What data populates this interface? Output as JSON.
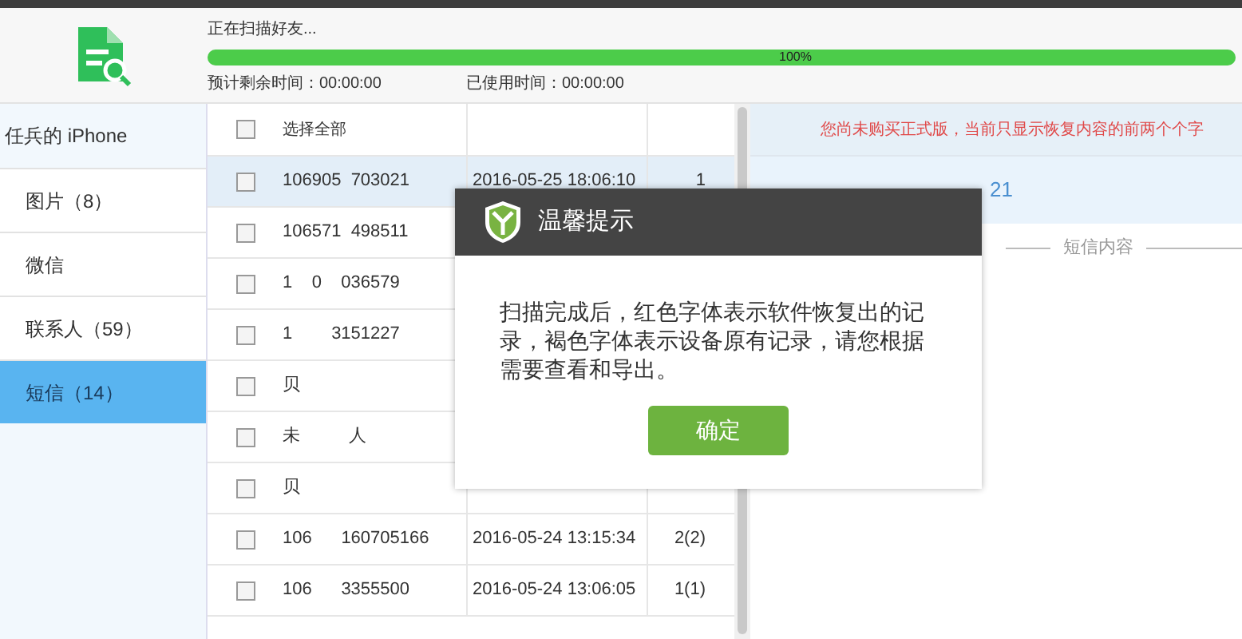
{
  "header": {
    "status": "正在扫描好友...",
    "progress": {
      "level": 1,
      "label": "100%"
    },
    "remaining": "预计剩余时间：00:00:00",
    "elapsed": "已使用时间：00:00:00"
  },
  "sidebar": {
    "device": "任兵的 iPhone",
    "items": [
      {
        "label": "图片（8）",
        "selected": false
      },
      {
        "label": "微信",
        "selected": false
      },
      {
        "label": "联系人（59）",
        "selected": false
      },
      {
        "label": "短信（14）",
        "selected": true
      }
    ]
  },
  "table": {
    "select_all": {
      "label": "选择全部",
      "checked": false
    },
    "rows": [
      {
        "sender": "106905  703021",
        "time": "2016-05-25 18:06:10",
        "count": "1",
        "checked": false,
        "selected": true
      },
      {
        "sender": "106571  498511",
        "checked": false,
        "selected": false
      },
      {
        "sender": "1    0    036579",
        "checked": false,
        "selected": false
      },
      {
        "sender": "1        3151227",
        "checked": false,
        "selected": false
      },
      {
        "sender": "贝",
        "checked": false,
        "selected": false
      },
      {
        "sender": "未          人",
        "checked": false,
        "selected": false
      },
      {
        "sender": "贝",
        "checked": false,
        "selected": false
      },
      {
        "sender": "106      160705166",
        "time": "2016-05-24 13:15:34",
        "count": "2(2)",
        "checked": false,
        "selected": false
      },
      {
        "sender": "106      3355500",
        "time": "2016-05-24 13:06:05",
        "count": "1(1)",
        "checked": false,
        "selected": false
      }
    ]
  },
  "detail": {
    "notice": "您尚未购买正式版，当前只显示恢复内容的前两个个字",
    "from_value": "21",
    "section": "短信内容"
  },
  "dialog": {
    "title": "温馨提示",
    "message": "扫描完成后，红色字体表示软件恢复出的记录，褐色字体表示设备原有记录，请您根据需要查看和导出。",
    "button": "确定"
  }
}
